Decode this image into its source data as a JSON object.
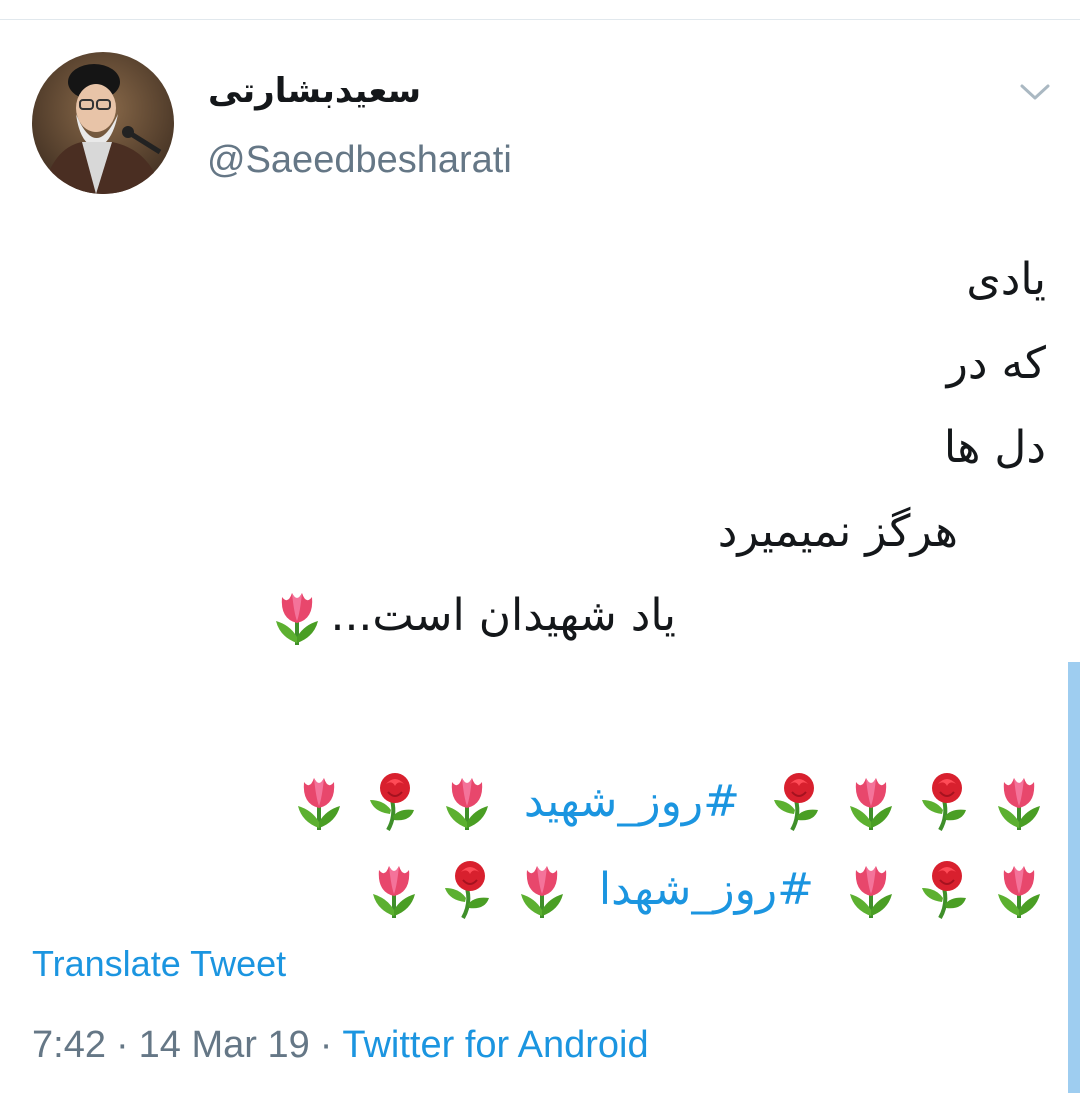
{
  "user": {
    "display_name": "سعیدبشارتی",
    "handle": "@Saeedbesharati",
    "avatar_icon": "profile-photo"
  },
  "tweet": {
    "lines": [
      "یادی",
      "که در",
      "دل ها",
      "هرگز نمیمیرد",
      "یاد شهیدان است..."
    ],
    "hashtags": [
      "#روز_شهید",
      "#روز_شهدا"
    ],
    "tulip_icon": "tulip-icon",
    "rose_icon": "rose-icon"
  },
  "translate_label": "Translate Tweet",
  "meta": {
    "time": "7:42",
    "separator": "·",
    "date": "14 Mar 19",
    "source": "Twitter for Android"
  },
  "colors": {
    "text": "#14171a",
    "secondary": "#657786",
    "link": "#1b95e0"
  }
}
